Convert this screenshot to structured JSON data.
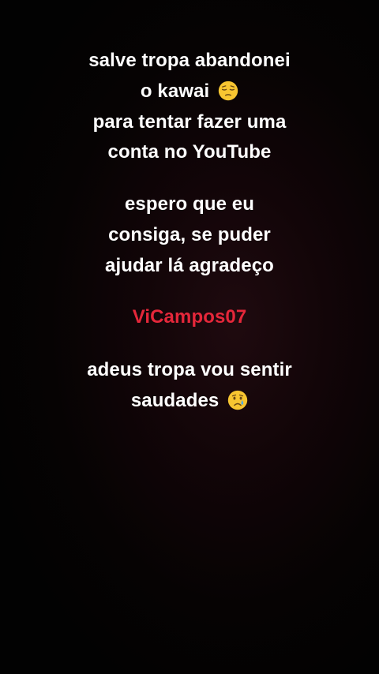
{
  "message": {
    "line1": "salve tropa abandonei",
    "line2": "o kawai",
    "line3": "para tentar fazer uma",
    "line4": "conta no YouTube",
    "line5": "espero que eu",
    "line6": "consiga, se puder",
    "line7": "ajudar lá agradeço",
    "channel_name": "ViCampos07",
    "line9": "adeus tropa vou sentir",
    "line10": "saudades"
  },
  "icons": {
    "line2_emoji": "pensive-face-icon",
    "line10_emoji": "crying-face-icon"
  },
  "colors": {
    "text": "#ffffff",
    "accent": "#e5273a",
    "background": "#0a0405"
  }
}
